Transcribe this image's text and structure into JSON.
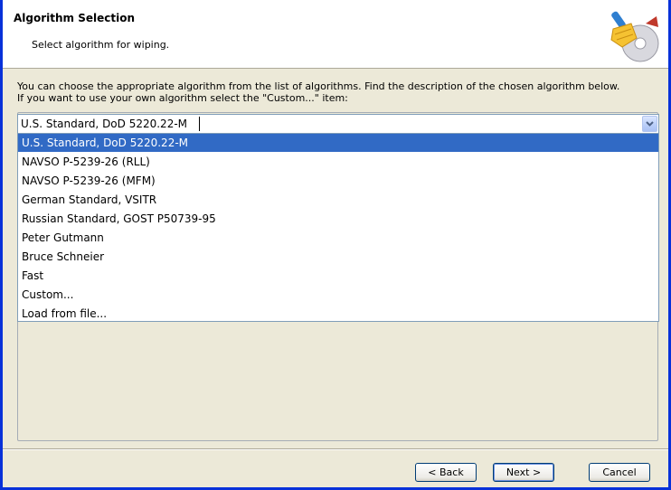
{
  "header": {
    "title": "Algorithm Selection",
    "subtitle": "Select algorithm for wiping."
  },
  "description": {
    "line1": "You can choose the appropriate algorithm from the list of algorithms. Find the description of the chosen algorithm below.",
    "line2": "If you want to use your own algorithm select the \"Custom...\" item:"
  },
  "combo": {
    "value": "U.S. Standard, DoD 5220.22-M"
  },
  "list": {
    "items": [
      "U.S. Standard, DoD 5220.22-M",
      "NAVSO P-5239-26 (RLL)",
      "NAVSO P-5239-26 (MFM)",
      "German Standard, VSITR",
      "Russian Standard, GOST P50739-95",
      "Peter Gutmann",
      "Bruce Schneier",
      "Fast",
      "Custom...",
      "Load from file..."
    ],
    "selected_index": 0
  },
  "buttons": {
    "back": "< Back",
    "next": "Next >",
    "cancel": "Cancel"
  },
  "colors": {
    "selection": "#316ac5",
    "window_border": "#0831d9",
    "dialog_bg": "#ece9d8"
  }
}
